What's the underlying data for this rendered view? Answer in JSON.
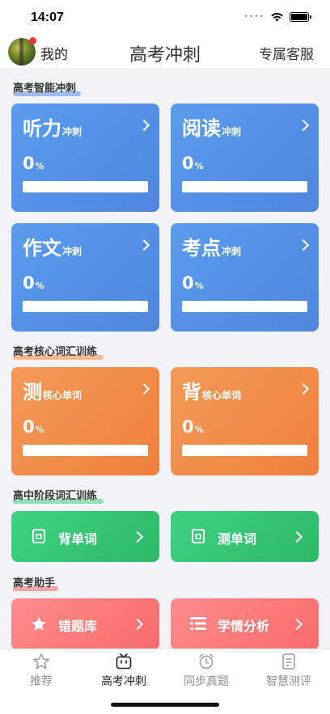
{
  "status_bar": {
    "time": "14:07",
    "signal_dots": "••••"
  },
  "nav": {
    "mine": "我的",
    "title": "高考冲刺",
    "service": "专属客服"
  },
  "sections": [
    {
      "title": "高考智能冲刺",
      "accent": "#9bbcf2"
    },
    {
      "title": "高考核心词汇训练",
      "accent": "#f5b98d"
    },
    {
      "title": "高中阶段词汇训练",
      "accent": "#8fe0b4"
    },
    {
      "title": "高考助手",
      "accent": "#f7a3a3"
    }
  ],
  "sprint_cards": [
    {
      "title": "听力",
      "sub": "冲刺",
      "percent": "0",
      "unit": "%",
      "progress": 0
    },
    {
      "title": "阅读",
      "sub": "冲刺",
      "percent": "0",
      "unit": "%",
      "progress": 0
    },
    {
      "title": "作文",
      "sub": "冲刺",
      "percent": "0",
      "unit": "%",
      "progress": 0
    },
    {
      "title": "考点",
      "sub": "冲刺",
      "percent": "0",
      "unit": "%",
      "progress": 0
    }
  ],
  "vocab_cards": [
    {
      "title": "测",
      "sub": "核心单词",
      "percent": "0",
      "unit": "%",
      "progress": 0
    },
    {
      "title": "背",
      "sub": "核心单词",
      "percent": "0",
      "unit": "%",
      "progress": 0
    }
  ],
  "stage_buttons": [
    {
      "label": "背单词",
      "icon": "book-icon"
    },
    {
      "label": "测单词",
      "icon": "book-icon"
    }
  ],
  "assistant_buttons": [
    {
      "label": "错题库",
      "icon": "star-icon"
    },
    {
      "label": "学情分析",
      "icon": "list-icon"
    }
  ],
  "tabs": [
    {
      "label": "推荐",
      "icon": "star-outline-icon",
      "active": false
    },
    {
      "label": "高考冲刺",
      "icon": "tv-icon",
      "active": true
    },
    {
      "label": "同步真题",
      "icon": "alarm-clock-icon",
      "active": false
    },
    {
      "label": "智慧测评",
      "icon": "document-icon",
      "active": false
    }
  ],
  "colors": {
    "sprint_card": "#5a9cee",
    "vocab_card": "#f49a59",
    "stage_button": "#3fd283",
    "assistant_button": "#fa6b6b",
    "notification_dot": "#f2352e"
  }
}
